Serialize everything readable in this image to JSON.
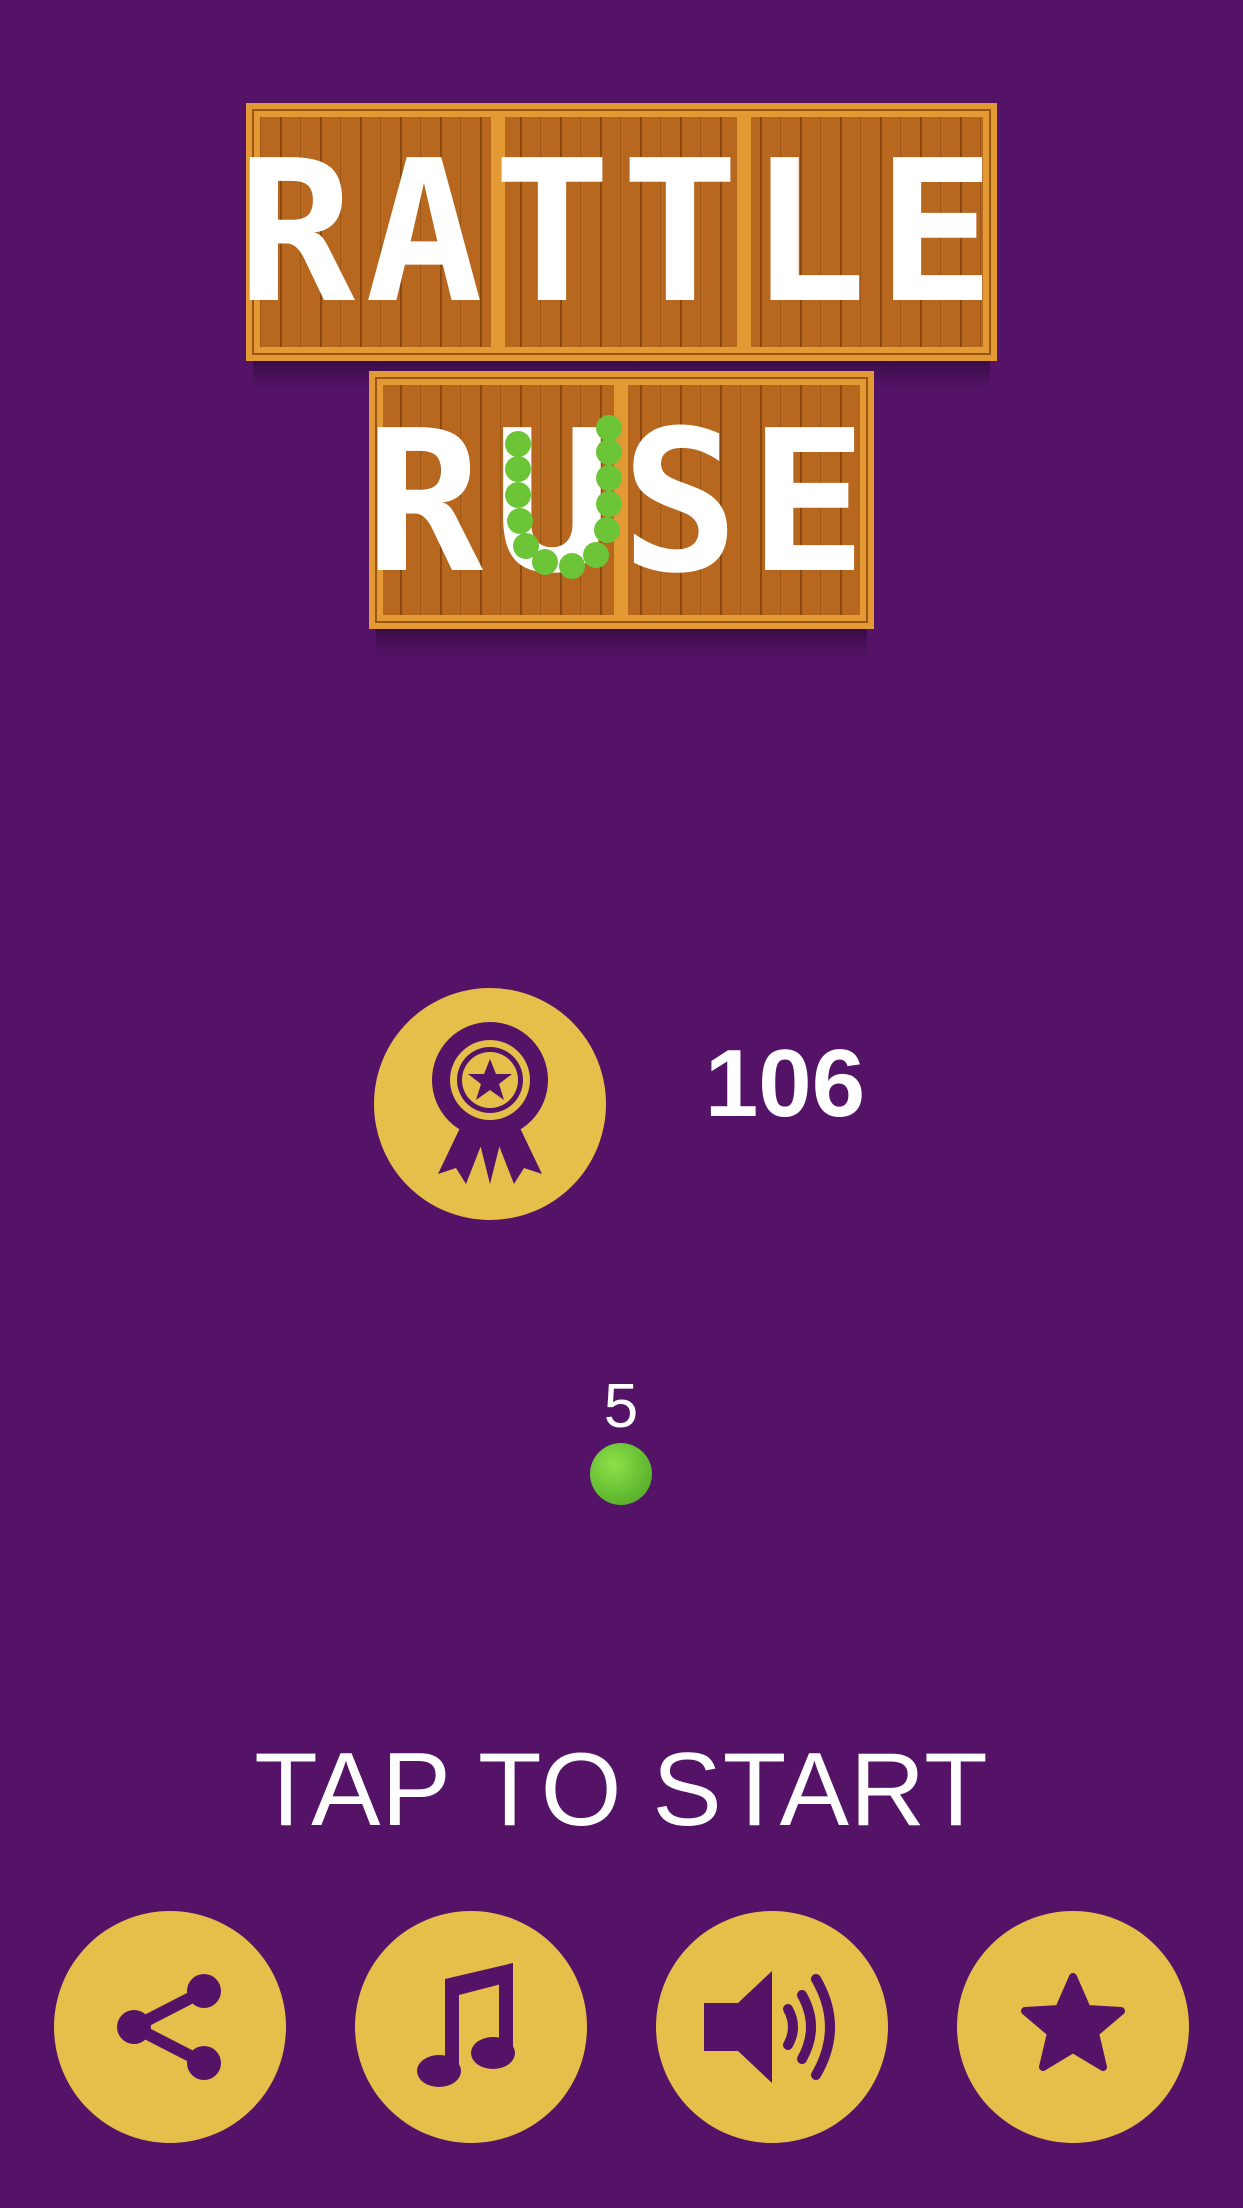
{
  "game": {
    "title_line1": "RATTLE",
    "title_line2": "RUSE"
  },
  "high_score": {
    "icon": "award-ribbon-icon",
    "value": "106"
  },
  "snake": {
    "length": "5",
    "ball_color": "#6CC537"
  },
  "prompt": {
    "start_text": "TAP TO START"
  },
  "toolbar": {
    "buttons": [
      {
        "icon": "share-icon"
      },
      {
        "icon": "music-icon"
      },
      {
        "icon": "sound-icon"
      },
      {
        "icon": "star-icon"
      }
    ]
  },
  "colors": {
    "background": "#541367",
    "button": "#E6BF4A",
    "crate": "#C4741F",
    "text": "#FFFFFF"
  }
}
